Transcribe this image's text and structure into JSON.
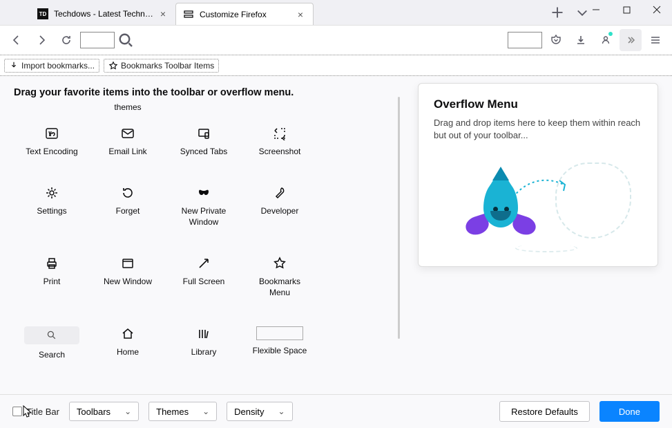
{
  "tabs": {
    "inactive": {
      "title": "Techdows - Latest Technology N"
    },
    "active": {
      "title": "Customize Firefox"
    }
  },
  "bookmarks_bar": {
    "import": "Import bookmarks...",
    "toolbar_items": "Bookmarks Toolbar Items"
  },
  "customize": {
    "instruction": "Drag your favorite items into the toolbar or overflow menu.",
    "partial_themes": "themes",
    "items": {
      "text_encoding": "Text Encoding",
      "email_link": "Email Link",
      "synced_tabs": "Synced Tabs",
      "screenshot": "Screenshot",
      "settings": "Settings",
      "forget": "Forget",
      "new_private": "New Private\nWindow",
      "developer": "Developer",
      "print": "Print",
      "new_window": "New Window",
      "full_screen": "Full Screen",
      "bookmarks_menu": "Bookmarks\nMenu",
      "search": "Search",
      "home": "Home",
      "library": "Library",
      "flexible_space": "Flexible Space"
    }
  },
  "overflow": {
    "title": "Overflow Menu",
    "desc": "Drag and drop items here to keep them within reach but out of your toolbar..."
  },
  "bottom": {
    "title_bar": "Title Bar",
    "toolbars": "Toolbars",
    "themes": "Themes",
    "density": "Density",
    "restore": "Restore Defaults",
    "done": "Done"
  }
}
